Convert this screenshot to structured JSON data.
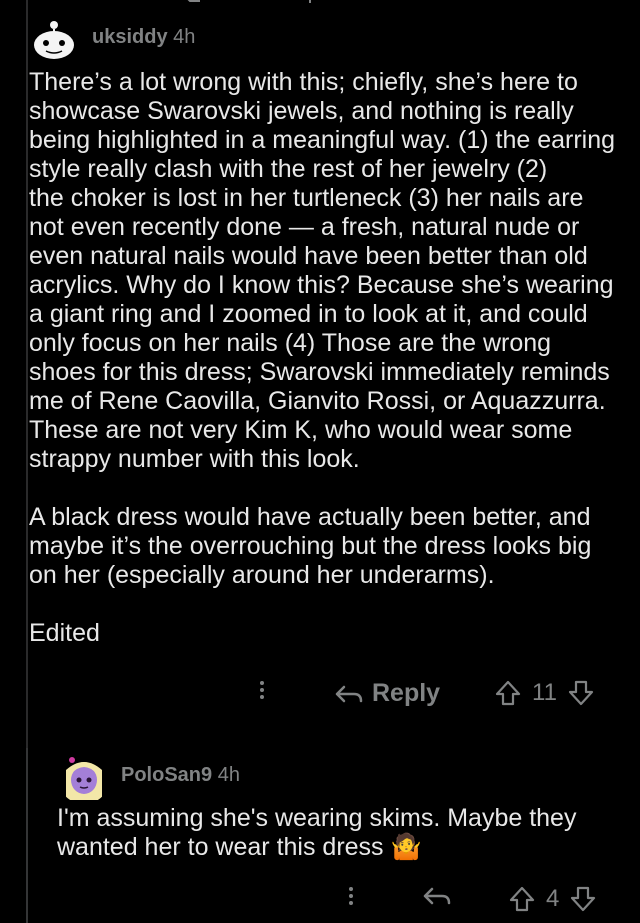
{
  "comment1": {
    "username": "uksiddy",
    "time": "4h",
    "body": "There’s a lot wrong with this; chiefly, she’s here to\nshowcase Swarovski jewels, and nothing is really\nbeing highlighted in a meaningful way. (1) the earring\nstyle really clash with the rest of her jewelry (2)\nthe choker is lost in her turtleneck (3) her nails are\nnot even recently done — a fresh, natural nude or\neven natural nails would have been better than old\nacrylics. Why do I know this? Because she’s wearing\na giant ring and I zoomed in to look at it, and could\nonly focus on her nails (4) Those are the wrong\nshoes for this dress; Swarovski immediately reminds\nme of Rene Caovilla, Gianvito Rossi, or Aquazzurra.\nThese are not very Kim K, who would wear some\nstrappy number with this look.\n\nA black dress would have actually been better, and\nmaybe it’s the overrouching but the dress looks big\non her (especially around her underarms).\n\nEdited",
    "reply_label": "Reply",
    "votes": "11"
  },
  "comment2": {
    "username": "PoloSan9",
    "time": "4h",
    "body": "I'm assuming she's wearing skims. Maybe they\nwanted her to wear this dress 🤷",
    "votes": "4"
  },
  "colors": {
    "background": "#000000",
    "text": "#e8e8e8",
    "muted": "#818384"
  },
  "icons": [
    "more-options-icon",
    "reply-arrow-icon",
    "upvote-icon",
    "downvote-icon",
    "avatar-snoo",
    "avatar-anime"
  ]
}
